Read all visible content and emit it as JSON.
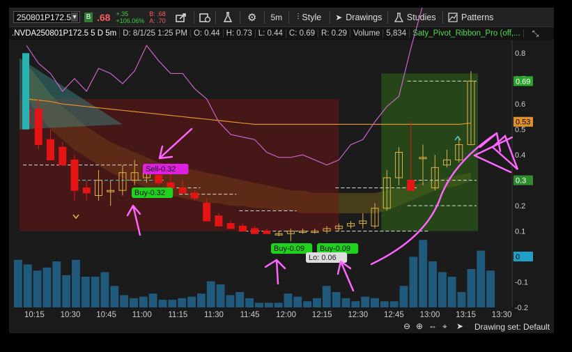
{
  "toolbar": {
    "symbol": "250801P172.5",
    "badge": "B",
    "last": ".68",
    "change_abs": "+.35",
    "change_pct": "+106.06%",
    "bid": "B: .68",
    "ask": "A: .70",
    "timeframe": "5m",
    "style_label": "Style",
    "drawings_label": "Drawings",
    "studies_label": "Studies",
    "patterns_label": "Patterns"
  },
  "info": {
    "symbol_desc": ".NVDA250801P172.5 5 D 5m",
    "date": "D: 8/1/25 1:25 PM",
    "open": "O: 0.44",
    "high": "H: 0.73",
    "low": "L: 0.44",
    "close": "C: 0.69",
    "range": "R: 0.29",
    "volume_label": "Volume",
    "volume_value": "5,834",
    "study": "Saty_Pivot_Ribbon_Pro (off,..."
  },
  "labels": {
    "sell": "Sell-0.32",
    "buy1": "Buy-0.32",
    "buy2": "Buy-0.09",
    "buy3": "Buy-0.09",
    "lo": "Lo: 0.06"
  },
  "price_axis": [
    "0.8",
    "0.7",
    "0.6",
    "0.5",
    "0.4",
    "0.3",
    "0.2",
    "0.1",
    "0",
    "-0.1",
    "-0.2"
  ],
  "price_tags": {
    "current": "0.69",
    "orange": "0.53",
    "green": "0.3",
    "zero": "0"
  },
  "time_axis": [
    "10:15",
    "10:30",
    "10:45",
    "11:00",
    "11:15",
    "11:30",
    "11:45",
    "12:00",
    "12:15",
    "12:30",
    "12:45",
    "13:00",
    "13:15",
    "13:30"
  ],
  "bottom": {
    "drawing_set": "Drawing set: Default"
  },
  "chart_data": {
    "type": "candlestick",
    "time_labels": [
      "10:15",
      "10:30",
      "10:45",
      "11:00",
      "11:15",
      "11:30",
      "11:45",
      "12:00",
      "12:15",
      "12:30",
      "12:45",
      "13:00",
      "13:15",
      "13:30"
    ],
    "ylim": [
      -0.2,
      0.85
    ],
    "candles": [
      {
        "o": 0.58,
        "h": 0.72,
        "l": 0.52,
        "c": 0.52,
        "dir": "down"
      },
      {
        "o": 0.58,
        "h": 0.62,
        "l": 0.42,
        "c": 0.44,
        "dir": "down"
      },
      {
        "o": 0.46,
        "h": 0.5,
        "l": 0.38,
        "c": 0.38,
        "dir": "down"
      },
      {
        "o": 0.43,
        "h": 0.45,
        "l": 0.36,
        "c": 0.36,
        "dir": "down"
      },
      {
        "o": 0.38,
        "h": 0.4,
        "l": 0.22,
        "c": 0.26,
        "dir": "down"
      },
      {
        "o": 0.27,
        "h": 0.3,
        "l": 0.22,
        "c": 0.25,
        "dir": "down"
      },
      {
        "o": 0.24,
        "h": 0.34,
        "l": 0.22,
        "c": 0.3,
        "dir": "up"
      },
      {
        "o": 0.26,
        "h": 0.3,
        "l": 0.2,
        "c": 0.26,
        "dir": "up"
      },
      {
        "o": 0.26,
        "h": 0.36,
        "l": 0.24,
        "c": 0.33,
        "dir": "up"
      },
      {
        "o": 0.3,
        "h": 0.38,
        "l": 0.28,
        "c": 0.33,
        "dir": "up"
      },
      {
        "o": 0.33,
        "h": 0.35,
        "l": 0.29,
        "c": 0.31,
        "dir": "up"
      },
      {
        "o": 0.32,
        "h": 0.35,
        "l": 0.28,
        "c": 0.29,
        "dir": "down"
      },
      {
        "o": 0.29,
        "h": 0.34,
        "l": 0.27,
        "c": 0.27,
        "dir": "down"
      },
      {
        "o": 0.27,
        "h": 0.3,
        "l": 0.25,
        "c": 0.25,
        "dir": "down"
      },
      {
        "o": 0.25,
        "h": 0.26,
        "l": 0.22,
        "c": 0.23,
        "dir": "down"
      },
      {
        "o": 0.21,
        "h": 0.23,
        "l": 0.14,
        "c": 0.14,
        "dir": "down"
      },
      {
        "o": 0.16,
        "h": 0.17,
        "l": 0.12,
        "c": 0.12,
        "dir": "down"
      },
      {
        "o": 0.13,
        "h": 0.14,
        "l": 0.11,
        "c": 0.11,
        "dir": "down"
      },
      {
        "o": 0.12,
        "h": 0.13,
        "l": 0.1,
        "c": 0.1,
        "dir": "down"
      },
      {
        "o": 0.11,
        "h": 0.12,
        "l": 0.09,
        "c": 0.09,
        "dir": "down"
      },
      {
        "o": 0.1,
        "h": 0.11,
        "l": 0.09,
        "c": 0.09,
        "dir": "down"
      },
      {
        "o": 0.09,
        "h": 0.1,
        "l": 0.08,
        "c": 0.09,
        "dir": "up"
      },
      {
        "o": 0.09,
        "h": 0.11,
        "l": 0.06,
        "c": 0.1,
        "dir": "up"
      },
      {
        "o": 0.1,
        "h": 0.11,
        "l": 0.09,
        "c": 0.1,
        "dir": "up"
      },
      {
        "o": 0.1,
        "h": 0.11,
        "l": 0.09,
        "c": 0.1,
        "dir": "up"
      },
      {
        "o": 0.1,
        "h": 0.12,
        "l": 0.09,
        "c": 0.11,
        "dir": "up"
      },
      {
        "o": 0.11,
        "h": 0.13,
        "l": 0.1,
        "c": 0.12,
        "dir": "up"
      },
      {
        "o": 0.12,
        "h": 0.14,
        "l": 0.11,
        "c": 0.13,
        "dir": "up"
      },
      {
        "o": 0.13,
        "h": 0.17,
        "l": 0.11,
        "c": 0.14,
        "dir": "up"
      },
      {
        "o": 0.12,
        "h": 0.21,
        "l": 0.11,
        "c": 0.19,
        "dir": "up"
      },
      {
        "o": 0.19,
        "h": 0.34,
        "l": 0.18,
        "c": 0.31,
        "dir": "up"
      },
      {
        "o": 0.31,
        "h": 0.43,
        "l": 0.28,
        "c": 0.41,
        "dir": "up"
      },
      {
        "o": 0.3,
        "h": 0.53,
        "l": 0.26,
        "c": 0.26,
        "dir": "down"
      },
      {
        "o": 0.39,
        "h": 0.44,
        "l": 0.28,
        "c": 0.39,
        "dir": "up"
      },
      {
        "o": 0.27,
        "h": 0.4,
        "l": 0.26,
        "c": 0.35,
        "dir": "up"
      },
      {
        "o": 0.36,
        "h": 0.42,
        "l": 0.35,
        "c": 0.38,
        "dir": "up"
      },
      {
        "o": 0.38,
        "h": 0.47,
        "l": 0.37,
        "c": 0.44,
        "dir": "up"
      },
      {
        "o": 0.44,
        "h": 0.73,
        "l": 0.44,
        "c": 0.69,
        "dir": "up"
      }
    ],
    "volume_relative": [
      0.62,
      0.56,
      0.48,
      0.52,
      0.6,
      0.42,
      0.62,
      0.4,
      0.4,
      0.46,
      0.28,
      0.16,
      0.12,
      0.14,
      0.18,
      0.1,
      0.1,
      0.12,
      0.14,
      0.18,
      0.34,
      0.3,
      0.16,
      0.2,
      0.12,
      0.06,
      0.06,
      0.06,
      0.18,
      0.14,
      0.08,
      0.12,
      0.28,
      0.2,
      0.12,
      0.08,
      0.14,
      0.12,
      0.08,
      0.08,
      0.28,
      0.66,
      0.88,
      0.6,
      0.46,
      0.4,
      0.2,
      0.5,
      0.74,
      0.48
    ]
  }
}
